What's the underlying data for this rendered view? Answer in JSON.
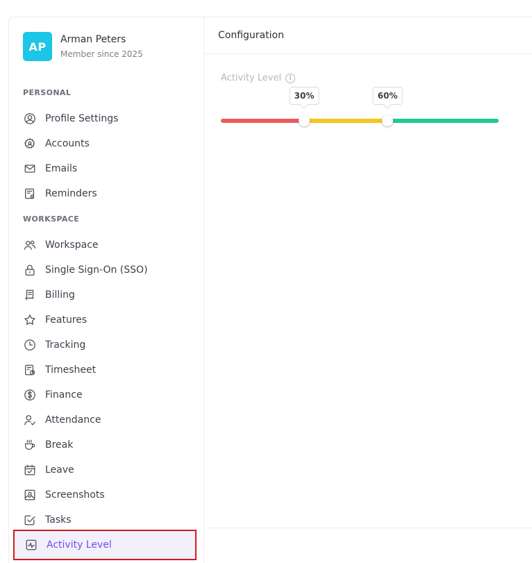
{
  "profile": {
    "initials": "AP",
    "name": "Arman Peters",
    "subtitle": "Member since 2025",
    "avatar_color": "#1cc6e6"
  },
  "sections": [
    {
      "label": "PERSONAL",
      "items": [
        {
          "label": "Profile Settings",
          "icon": "user-circle-icon"
        },
        {
          "label": "Accounts",
          "icon": "gear-user-icon"
        },
        {
          "label": "Emails",
          "icon": "envelope-icon"
        },
        {
          "label": "Reminders",
          "icon": "reminder-bell-icon"
        }
      ]
    },
    {
      "label": "WORKSPACE",
      "items": [
        {
          "label": "Workspace",
          "icon": "users-icon"
        },
        {
          "label": "Single Sign-On (SSO)",
          "icon": "lock-icon"
        },
        {
          "label": "Billing",
          "icon": "receipt-icon"
        },
        {
          "label": "Features",
          "icon": "star-icon"
        },
        {
          "label": "Tracking",
          "icon": "clock-icon"
        },
        {
          "label": "Timesheet",
          "icon": "timesheet-icon"
        },
        {
          "label": "Finance",
          "icon": "dollar-circle-icon"
        },
        {
          "label": "Attendance",
          "icon": "user-check-icon"
        },
        {
          "label": "Break",
          "icon": "coffee-cup-icon"
        },
        {
          "label": "Leave",
          "icon": "calendar-check-icon"
        },
        {
          "label": "Screenshots",
          "icon": "image-icon"
        },
        {
          "label": "Tasks",
          "icon": "task-check-icon"
        },
        {
          "label": "Activity Level",
          "icon": "activity-pulse-icon",
          "active": true
        }
      ]
    }
  ],
  "content": {
    "title": "Configuration",
    "field_label": "Activity Level",
    "slider": {
      "low_threshold": 30,
      "high_threshold": 60,
      "low_label": "30%",
      "high_label": "60%",
      "colors": {
        "low": "#ec5b5b",
        "mid": "#f4c81a",
        "high": "#22c98d"
      }
    }
  },
  "accent_color": "#6c4ff0"
}
